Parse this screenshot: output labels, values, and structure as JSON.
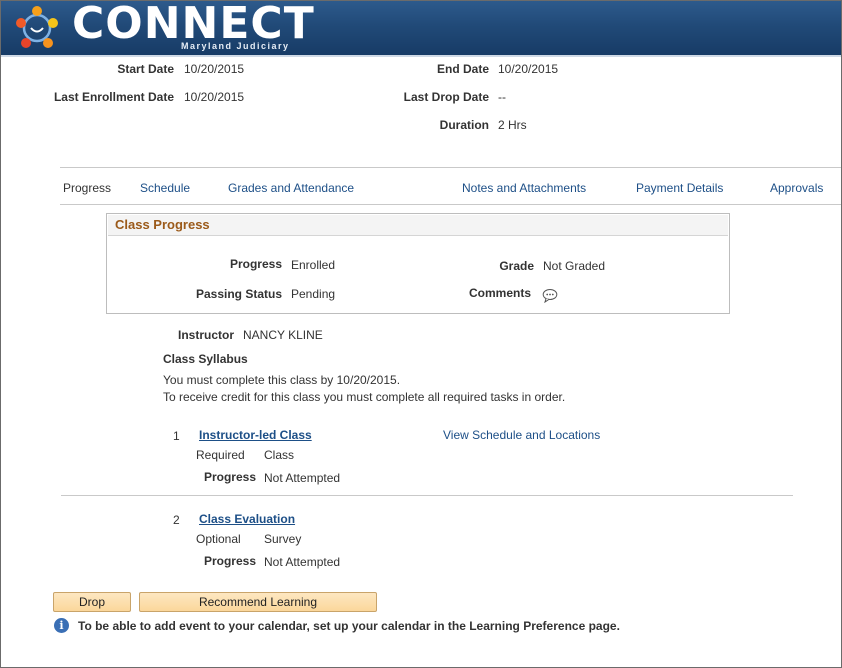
{
  "header": {
    "brand": "CONNECT",
    "tagline": "Maryland Judiciary"
  },
  "summary": {
    "start_date_label": "Start Date",
    "start_date": "10/20/2015",
    "end_date_label": "End Date",
    "end_date": "10/20/2015",
    "last_enrollment_label": "Last Enrollment Date",
    "last_enrollment": "10/20/2015",
    "last_drop_label": "Last Drop Date",
    "last_drop": "--",
    "duration_label": "Duration",
    "duration": "2 Hrs"
  },
  "tabs": [
    {
      "label": "Progress"
    },
    {
      "label": "Schedule"
    },
    {
      "label": "Grades and Attendance"
    },
    {
      "label": "Notes and Attachments"
    },
    {
      "label": "Payment Details"
    },
    {
      "label": "Approvals"
    }
  ],
  "class_progress": {
    "title": "Class Progress",
    "progress_label": "Progress",
    "progress": "Enrolled",
    "grade_label": "Grade",
    "grade": "Not Graded",
    "passing_label": "Passing Status",
    "passing": "Pending",
    "comments_label": "Comments"
  },
  "instructor": {
    "label": "Instructor",
    "name": "NANCY KLINE"
  },
  "syllabus": {
    "title": "Class Syllabus",
    "line1": "You must complete this class by 10/20/2015.",
    "line2": "To receive credit for this class you must complete all required tasks in order."
  },
  "tasks": [
    {
      "number": "1",
      "title": "Instructor-led Class",
      "requirement": "Required",
      "type": "Class",
      "progress_label": "Progress",
      "progress": "Not Attempted",
      "schedule_link": "View Schedule and Locations"
    },
    {
      "number": "2",
      "title": "Class Evaluation",
      "requirement": "Optional",
      "type": "Survey",
      "progress_label": "Progress",
      "progress": "Not Attempted"
    }
  ],
  "buttons": {
    "drop": "Drop",
    "recommend": "Recommend Learning"
  },
  "info": {
    "icon": "info-icon",
    "text": "To be able to add event to your calendar, set up your calendar in the Learning Preference page."
  },
  "colors": {
    "banner": "#214a78",
    "link": "#1d4f87",
    "section_title": "#9b5a1a",
    "button": "#fbd79b"
  }
}
